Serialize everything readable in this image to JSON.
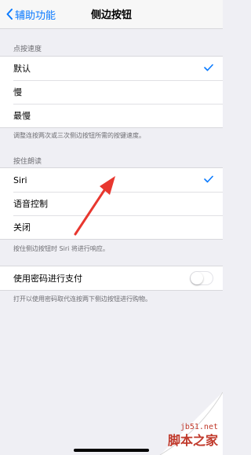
{
  "nav": {
    "back_label": "辅助功能",
    "title": "侧边按钮"
  },
  "click_speed": {
    "header": "点按速度",
    "options": [
      {
        "label": "默认",
        "selected": true
      },
      {
        "label": "慢",
        "selected": false
      },
      {
        "label": "最慢",
        "selected": false
      }
    ],
    "footer": "调整连按两次或三次侧边按钮所需的按键速度。"
  },
  "press_hold": {
    "header": "按住朗读",
    "options": [
      {
        "label": "Siri",
        "selected": true
      },
      {
        "label": "语音控制",
        "selected": false
      },
      {
        "label": "关闭",
        "selected": false
      }
    ],
    "footer": "按住侧边按钮时 Siri 将进行响应。"
  },
  "passcode_payment": {
    "label": "使用密码进行支付",
    "enabled": false,
    "footer": "打开以使用密码取代连按两下侧边按钮进行购物。"
  },
  "watermark": {
    "url": "jb51.net",
    "name": "脚本之家"
  },
  "colors": {
    "accent": "#0a7aff",
    "annotation_arrow": "#e8372f"
  }
}
